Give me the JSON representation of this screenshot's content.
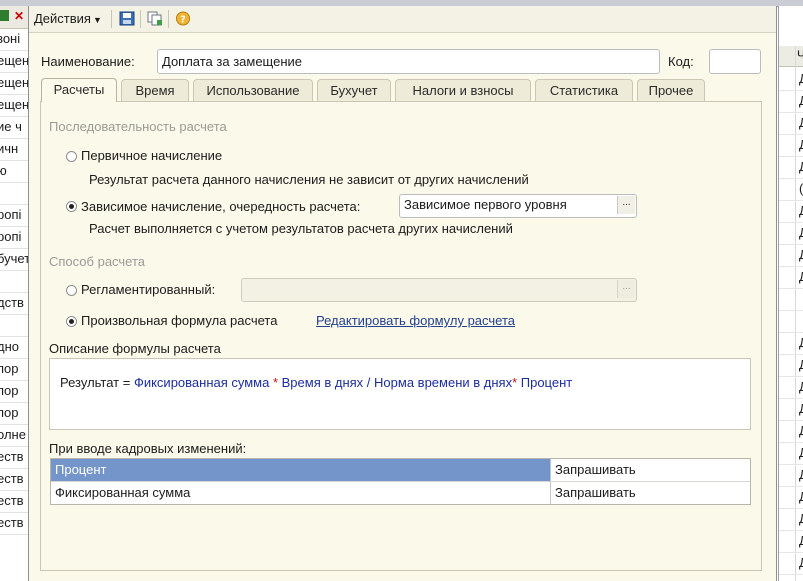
{
  "background": {
    "left_rows": [
      "зоні",
      "ещен",
      "ещен",
      "ещен",
      "ие ч",
      "ичн",
      "ю",
      "",
      "ропі",
      "ропі",
      "бучет",
      "",
      "дств",
      "",
      "дно",
      "пор",
      "пор",
      "пор",
      "олне",
      "еств",
      "еств",
      "еств",
      "еств"
    ],
    "right_header": "Ч",
    "right_rows": [
      "Д",
      "Д",
      "Д",
      "Д",
      "Д",
      "(",
      "Д",
      "Д",
      "Д",
      "Д",
      "",
      "",
      "Д",
      "Д",
      "Д",
      "Д",
      "Д",
      "Д",
      "Д",
      "Д",
      "Д",
      "Д",
      "Д"
    ]
  },
  "toolbar": {
    "actions_label": "Действия",
    "icons": [
      "save-icon",
      "copy-icon",
      "help-icon"
    ]
  },
  "header": {
    "name_label": "Наименование:",
    "name_value": "Доплата за замещение",
    "code_label": "Код:",
    "code_value": ""
  },
  "tabs": [
    {
      "label": "Расчеты",
      "active": true
    },
    {
      "label": "Время",
      "active": false
    },
    {
      "label": "Использование",
      "active": false
    },
    {
      "label": "Бухучет",
      "active": false
    },
    {
      "label": "Налоги и взносы",
      "active": false
    },
    {
      "label": "Статистика",
      "active": false
    },
    {
      "label": "Прочее",
      "active": false
    }
  ],
  "calc_order": {
    "title": "Последовательность расчета",
    "primary_label": "Первичное начисление",
    "primary_hint": "Результат расчета данного начисления не зависит от других начислений",
    "dependent_label": "Зависимое начисление, очередность расчета:",
    "dependent_value": "Зависимое первого уровня",
    "dependent_hint": "Расчет выполняется с учетом результатов расчета других начислений",
    "choose_glyph": "..."
  },
  "calc_method": {
    "title": "Способ расчета",
    "regulated_label": "Регламентированный:",
    "regulated_value": "",
    "custom_label": "Произвольная формула расчета",
    "edit_formula_link": "Редактировать формулу расчета",
    "choose_glyph": "..."
  },
  "formula": {
    "label": "Описание формулы расчета",
    "result": "Результат",
    "eq": " = ",
    "t1": "Фиксированная сумма",
    "op1": " * ",
    "t2": "Время в днях",
    "op2": " / ",
    "t3": "Норма времени в днях",
    "op3": "* ",
    "t4": "Процент"
  },
  "hr_changes": {
    "label": "При вводе кадровых изменений:",
    "rows": [
      {
        "name": "Процент",
        "action": "Запрашивать",
        "selected": true
      },
      {
        "name": "Фиксированная сумма",
        "action": "Запрашивать",
        "selected": false
      }
    ]
  }
}
